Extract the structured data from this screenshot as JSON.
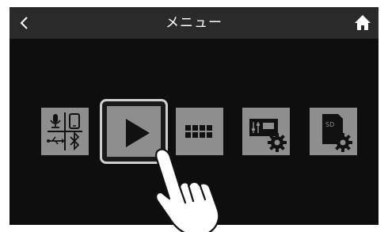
{
  "header": {
    "title": "メニュー",
    "back_icon": "chevron-left-icon",
    "home_icon": "home-icon"
  },
  "menu": {
    "tiles": [
      {
        "name": "input-output-settings",
        "icon": "mic-phone-usb-bluetooth-icon"
      },
      {
        "name": "play",
        "icon": "play-icon",
        "selected": true
      },
      {
        "name": "grid-menu",
        "icon": "grid-icon"
      },
      {
        "name": "mixer-settings",
        "icon": "mixer-gear-icon"
      },
      {
        "name": "sd-card-settings",
        "icon": "sd-card-gear-icon"
      }
    ]
  },
  "colors": {
    "background": "#0e0e0e",
    "header": "#2a2a2a",
    "tile": "#8e8e8e",
    "selection_frame": "#cfcfcf"
  }
}
